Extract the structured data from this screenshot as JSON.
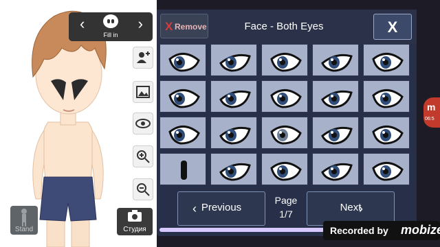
{
  "editor": {
    "fill_label": "Fill in",
    "stand_label": "Stand",
    "studio_label": "Студия",
    "tools": [
      "add-character-icon",
      "background-icon",
      "eye-icon",
      "zoom-in-icon",
      "zoom-out-icon"
    ]
  },
  "panel": {
    "remove_icon": "X",
    "remove_label": "Remove",
    "title": "Face - Both Eyes",
    "close_label": "X",
    "previous_label": "Previous",
    "next_label": "Next",
    "page_label": "Page",
    "page_value": "1/7"
  },
  "recorder": {
    "recorded_by": "Recorded by",
    "brand": "mobizen",
    "badge_letter": "m",
    "badge_time": "06:5"
  },
  "colors": {
    "panel_bg": "#283049",
    "cell_bg": "#a7b1c9",
    "remove_x": "#d33c3c",
    "iris": "#2f4d78"
  }
}
